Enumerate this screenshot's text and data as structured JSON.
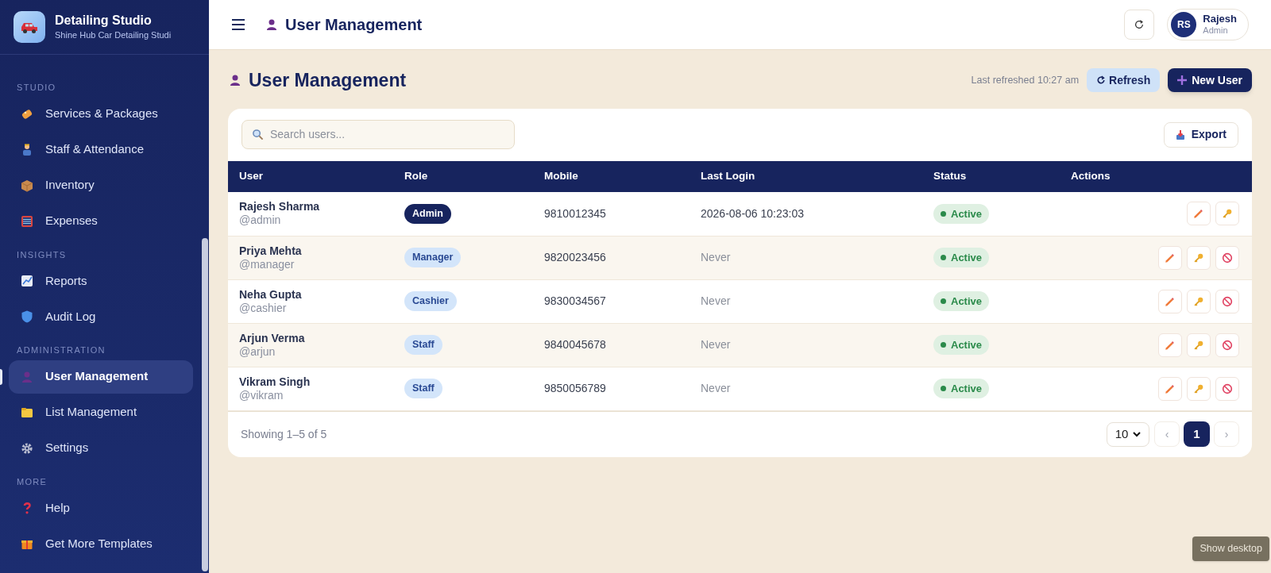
{
  "brand": {
    "title": "Detailing Studio",
    "subtitle": "Shine Hub Car Detailing Studi"
  },
  "sidebar": {
    "sections": [
      {
        "label": "STUDIO",
        "items": [
          {
            "label": "Services & Packages",
            "selected": false
          },
          {
            "label": "Staff & Attendance",
            "selected": false
          },
          {
            "label": "Inventory",
            "selected": false
          },
          {
            "label": "Expenses",
            "selected": false
          }
        ]
      },
      {
        "label": "INSIGHTS",
        "items": [
          {
            "label": "Reports",
            "selected": false
          },
          {
            "label": "Audit Log",
            "selected": false
          }
        ]
      },
      {
        "label": "ADMINISTRATION",
        "items": [
          {
            "label": "User Management",
            "selected": true
          },
          {
            "label": "List Management",
            "selected": false
          },
          {
            "label": "Settings",
            "selected": false
          }
        ]
      },
      {
        "label": "MORE",
        "items": [
          {
            "label": "Help",
            "selected": false
          },
          {
            "label": "Get More Templates",
            "selected": false
          }
        ]
      }
    ]
  },
  "topbar": {
    "title": "User Management",
    "user": {
      "initials": "RS",
      "name": "Rajesh",
      "role": "Admin"
    }
  },
  "page": {
    "title": "User Management",
    "last_refreshed": "Last refreshed 10:27 am",
    "refresh_button": "Refresh",
    "new_button": "New User"
  },
  "toolbar": {
    "search": {
      "placeholder": "Search users..."
    },
    "export_button": "Export"
  },
  "table": {
    "columns": [
      "User",
      "Role",
      "Mobile",
      "Last Login",
      "Status",
      "Actions"
    ],
    "rows": [
      {
        "name": "Rajesh Sharma",
        "username": "@admin",
        "role": {
          "text": "Admin",
          "kind": "admin"
        },
        "mobile": "9810012345",
        "last_login": "2026-08-06 10:23:03",
        "never": false,
        "status": "Active",
        "can_disable": false
      },
      {
        "name": "Priya Mehta",
        "username": "@manager",
        "role": {
          "text": "Manager",
          "kind": "other"
        },
        "mobile": "9820023456",
        "last_login": "Never",
        "never": true,
        "status": "Active",
        "can_disable": true
      },
      {
        "name": "Neha Gupta",
        "username": "@cashier",
        "role": {
          "text": "Cashier",
          "kind": "other"
        },
        "mobile": "9830034567",
        "last_login": "Never",
        "never": true,
        "status": "Active",
        "can_disable": true
      },
      {
        "name": "Arjun Verma",
        "username": "@arjun",
        "role": {
          "text": "Staff",
          "kind": "other"
        },
        "mobile": "9840045678",
        "last_login": "Never",
        "never": true,
        "status": "Active",
        "can_disable": true
      },
      {
        "name": "Vikram Singh",
        "username": "@vikram",
        "role": {
          "text": "Staff",
          "kind": "other"
        },
        "mobile": "9850056789",
        "last_login": "Never",
        "never": true,
        "status": "Active",
        "can_disable": true
      }
    ]
  },
  "footer": {
    "summary": "Showing 1–5 of 5",
    "page_size": "10",
    "prev": "‹",
    "pages": [
      {
        "label": "1",
        "selected": true
      }
    ],
    "next": "›"
  },
  "tooltip": "Show desktop"
}
